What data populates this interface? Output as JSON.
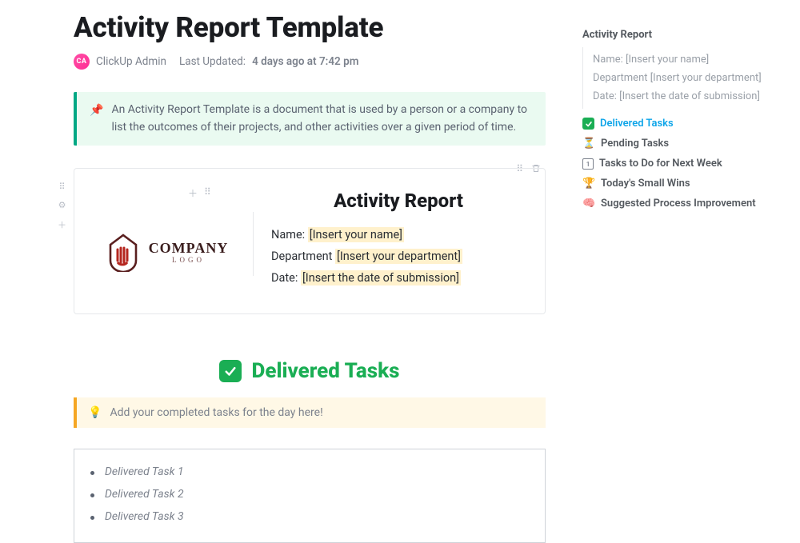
{
  "page": {
    "title": "Activity Report Template",
    "author_initials": "CA",
    "author": "ClickUp Admin",
    "last_updated_label": "Last Updated:",
    "last_updated_value": "4 days ago at 7:42 pm"
  },
  "callout": {
    "icon": "📌",
    "text": "An Activity Report Template is a document that is used by a person or a company to list the outcomes of their projects, and other activities over a given period of time."
  },
  "card": {
    "heading": "Activity Report",
    "logo_primary": "COMPANY",
    "logo_secondary": "LOGO",
    "fields": {
      "name_label": "Name: ",
      "name_value": "[Insert your name]",
      "dept_label": "Department ",
      "dept_value": "[Insert your department]",
      "date_label": "Date: ",
      "date_value": "[Insert the date of submission]"
    }
  },
  "delivered": {
    "heading": "Delivered Tasks",
    "tip_icon": "💡",
    "tip_text": "Add your completed tasks for the day here!",
    "items": [
      "Delivered Task 1",
      "Delivered Task 2",
      "Delivered Task 3"
    ]
  },
  "outline": {
    "title": "Activity Report",
    "indented": [
      "Name: [Insert your name]",
      "Department [Insert your department]",
      "Date: [Insert the date of submission]"
    ],
    "items": [
      {
        "id": "delivered",
        "label": "Delivered Tasks",
        "icon": "check",
        "active": true
      },
      {
        "id": "pending",
        "label": "Pending Tasks",
        "icon": "⏳",
        "active": false
      },
      {
        "id": "nextweek",
        "label": "Tasks to Do for Next Week",
        "icon": "calendar",
        "active": false
      },
      {
        "id": "wins",
        "label": "Today's Small Wins",
        "icon": "🏆",
        "active": false
      },
      {
        "id": "process",
        "label": "Suggested Process Improvement",
        "icon": "🧠",
        "active": false
      }
    ]
  }
}
